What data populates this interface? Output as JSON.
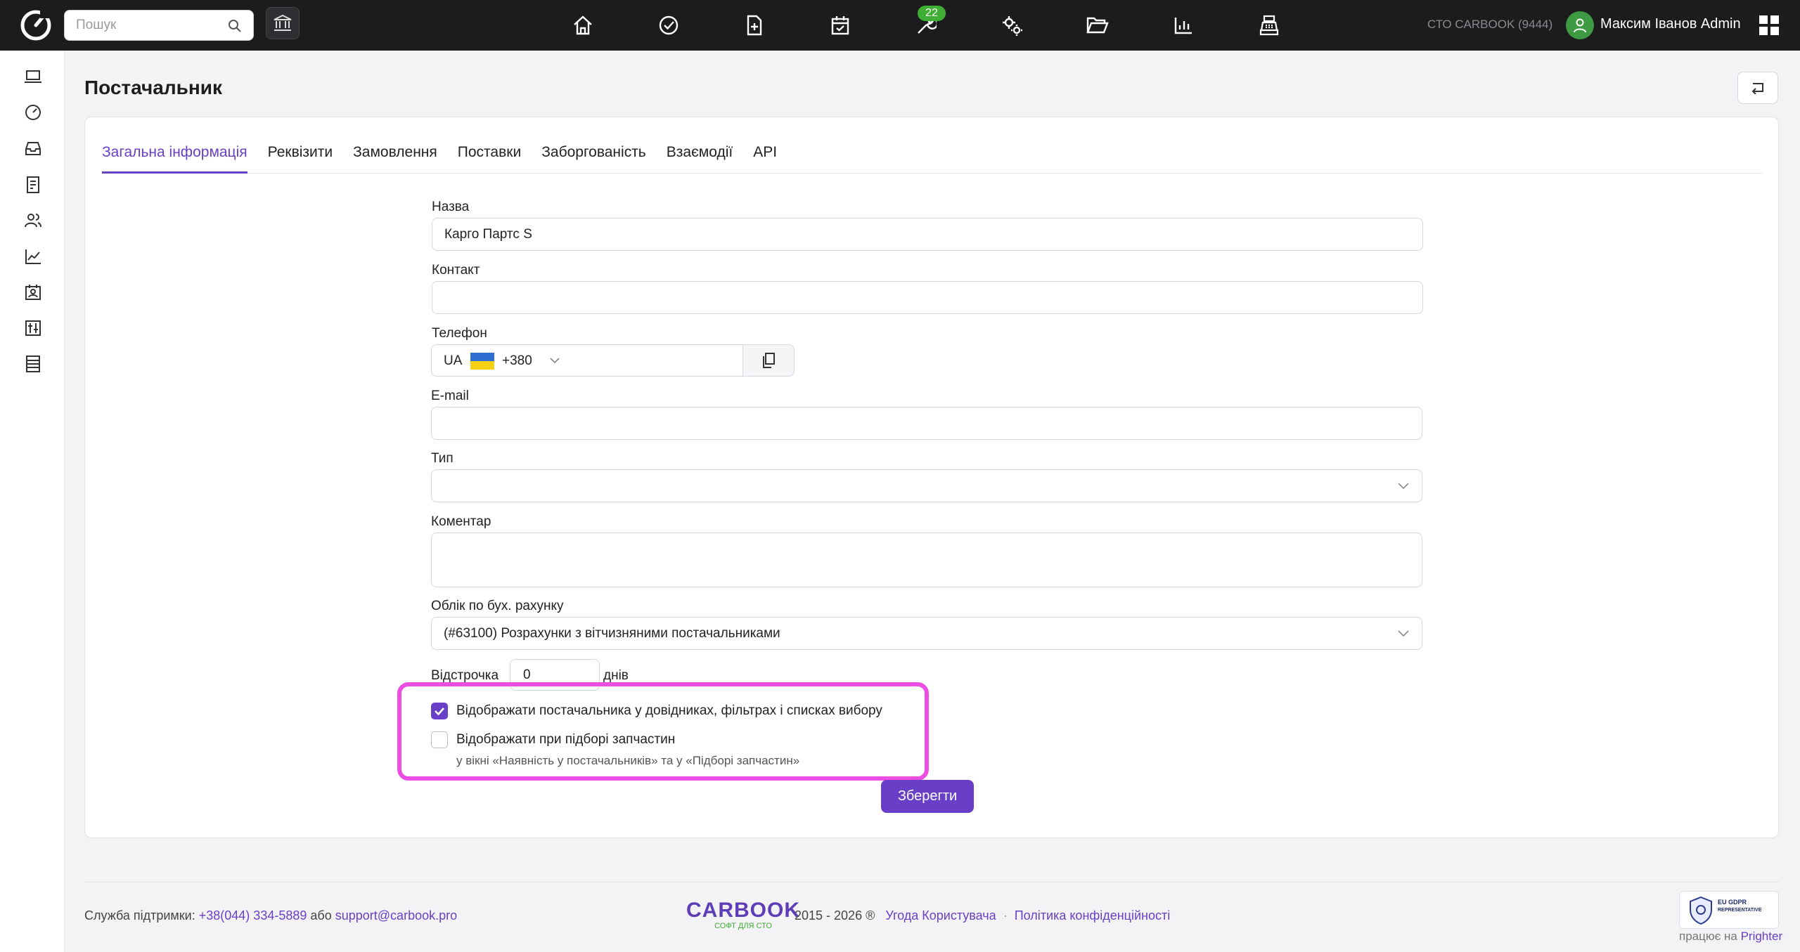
{
  "topbar": {
    "search_placeholder": "Пошук",
    "badge_count": "22",
    "org": "СТО CARBOOK (9444)",
    "user": "Максим Іванов Admin",
    "nav_icons": [
      "home-icon",
      "check-circle-icon",
      "file-plus-icon",
      "calendar-check-icon",
      "wrench-icon",
      "gears-icon",
      "folder-open-icon",
      "bar-chart-icon",
      "cash-register-icon"
    ]
  },
  "sidebar": {
    "icons": [
      "laptop-icon",
      "dashboard-icon",
      "inbox-icon",
      "document-list-icon",
      "users-icon",
      "line-chart-icon",
      "contact-card-icon",
      "sliders-icon",
      "table-icon"
    ]
  },
  "page": {
    "title": "Постачальник"
  },
  "tabs": [
    "Загальна інформація",
    "Реквізити",
    "Замовлення",
    "Поставки",
    "Заборгованість",
    "Взаємодії",
    "API"
  ],
  "form": {
    "name_label": "Назва",
    "name_value": "Карго Партс S",
    "contact_label": "Контакт",
    "contact_value": "",
    "phone_label": "Телефон",
    "phone_country": "UA",
    "phone_code": "+380",
    "phone_value": "",
    "email_label": "E-mail",
    "email_value": "",
    "type_label": "Тип",
    "type_value": "",
    "comment_label": "Коментар",
    "comment_value": "",
    "account_label": "Облік по бух. рахунку",
    "account_value": "(#63100) Розрахунки з вітчизняними постачальниками",
    "delay_label": "Відстрочка",
    "delay_value": "0",
    "delay_unit": "днів",
    "show_in_directories_label": "Відображати постачальника у довідниках, фільтрах і списках вибору",
    "show_in_directories_checked": true,
    "show_in_parts_label": "Відображати при підборі запчастин",
    "show_in_parts_sub": "у вікні «Наявність у постачальників» та у «Підборі запчастин»",
    "show_in_parts_checked": false,
    "save_label": "Зберегти"
  },
  "footer": {
    "support_label": "Служба підтримки:",
    "phone": "+38(044) 334-5889",
    "or": "або",
    "email": "support@carbook.pro",
    "brand": "CARBOOK",
    "brand_tagline": "СОФТ ДЛЯ СТО",
    "years": "2015 - 2026 ®",
    "terms": "Угода Користувача",
    "dot": "·",
    "privacy": "Політика конфіденційності",
    "gdpr_line1": "EU GDPR",
    "gdpr_line2": "REPRESENTATIVE",
    "powered_prefix": "працює на",
    "powered_link": "Prighter"
  },
  "colors": {
    "accent": "#6a3fc7",
    "highlight": "#ec4ee3",
    "badge": "#3fae34",
    "topbar": "#1c1c1e"
  }
}
